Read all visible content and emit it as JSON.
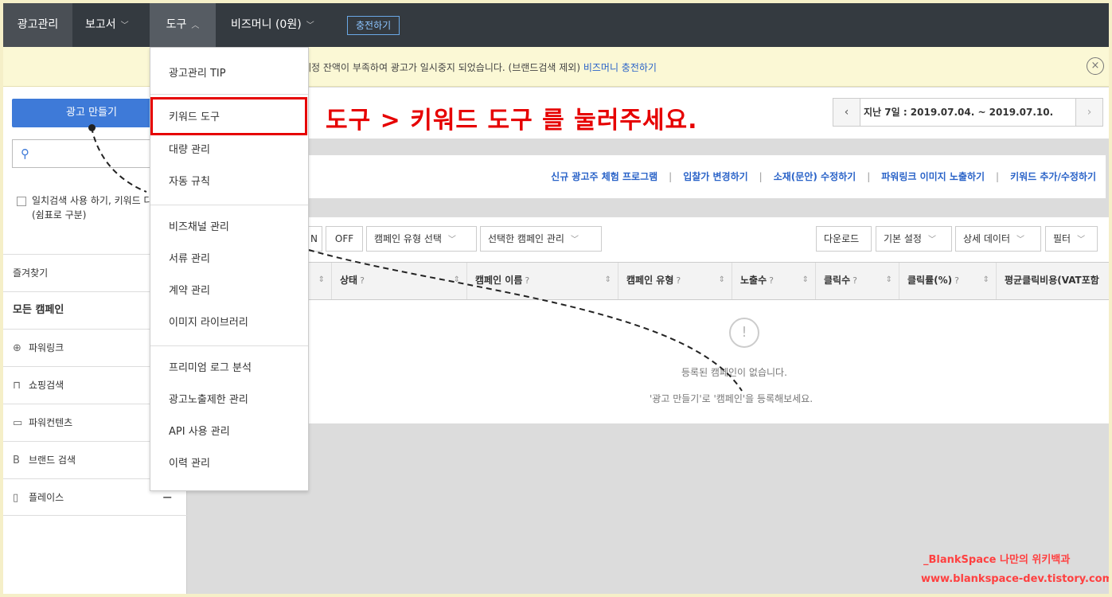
{
  "nav": {
    "ad_manage": "광고관리",
    "report": "보고서",
    "tools": "도구",
    "biz_money": "비즈머니 (0원)",
    "charge": "충전하기",
    "chevron_down": "﹀",
    "chevron_up": "︿"
  },
  "notice": {
    "text": "계정 잔액이 부족하여 광고가 일시중지 되었습니다. (브랜드검색 제외) ",
    "link": "비즈머니 충전하기",
    "close": "×"
  },
  "tools_menu": {
    "items": [
      "광고관리 TIP",
      "키워드 도구",
      "대량 관리",
      "자동 규칙",
      "비즈채널 관리",
      "서류 관리",
      "계약 관리",
      "이미지 라이브러리",
      "프리미엄 로그 분석",
      "광고노출제한 관리",
      "API 사용 관리",
      "이력 관리"
    ]
  },
  "instruction": "도구 > 키워드 도구 를 눌러주세요.",
  "sidebar": {
    "create_button": "광고 만들기",
    "search_placeholder": "",
    "exact_search": "일치검색 사용 하기, 키워드 다중검색(쉼표로 구분)",
    "favorites": "즐겨찾기",
    "all_campaigns": "모든 캠페인",
    "items": [
      {
        "icon": "globe-icon",
        "glyph": "⊕",
        "label": "파워링크"
      },
      {
        "icon": "shopping-bag-icon",
        "glyph": "⊓",
        "label": "쇼핑검색"
      },
      {
        "icon": "chat-icon",
        "glyph": "▭",
        "label": "파워컨텐츠"
      },
      {
        "icon": "brand-icon",
        "glyph": "B",
        "label": "브랜드 검색"
      },
      {
        "icon": "map-icon",
        "glyph": "▯",
        "label": "플레이스"
      }
    ],
    "minus": "−"
  },
  "date": {
    "prev": "‹",
    "next": "›",
    "range": "지난 7일 :  2019.07.04.  ~  2019.07.10."
  },
  "quick_links": [
    "신규 광고주 체험 프로그램",
    "입찰가 변경하기",
    "소재(문안) 수정하기",
    "파워링크 이미지 노출하기",
    "키워드 추가/수정하기"
  ],
  "toolbar": {
    "on": "N",
    "off": "OFF",
    "campaign_type": "캠페인 유형 선택",
    "manage_selected": "선택한 캠페인 관리",
    "download": "다운로드",
    "basic_settings": "기본 설정",
    "detail_data": "상세 데이터",
    "filter": "필터",
    "caret": "﹀"
  },
  "table": {
    "headers": [
      "",
      "상태",
      "캠페인 이름",
      "캠페인 유형",
      "노출수",
      "클릭수",
      "클릭률(%)",
      "평균클릭비용(VAT포함"
    ],
    "question": "?",
    "sort": "⇕",
    "empty_icon": "!",
    "empty_line1": "등록된 캠페인이 없습니다.",
    "empty_line2": "'광고 만들기'로 '캠페인'을 등록해보세요."
  },
  "watermark": {
    "line1": "_BlankSpace 나만의 위키백과",
    "line2": "www.blankspace-dev.tistory.com"
  },
  "colors": {
    "nav_bg": "#343a40",
    "accent_blue": "#3e7ad8",
    "link_blue": "#2a63c8",
    "instruction_red": "#e60000",
    "notice_bg": "#fbf8d5"
  }
}
